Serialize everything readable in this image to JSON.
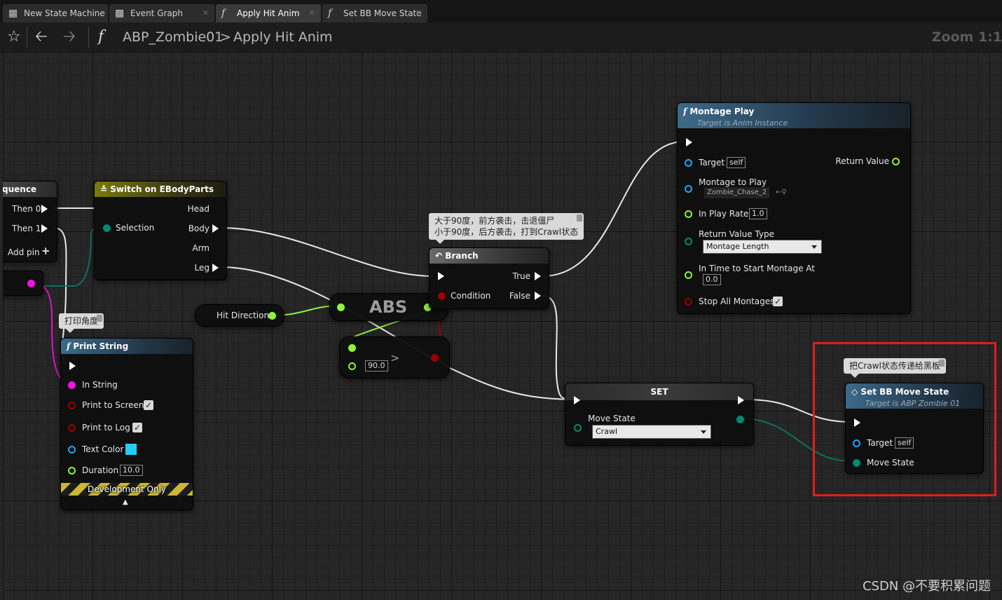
{
  "tabs": [
    {
      "label": "New State Machine",
      "icon": "state-machine-icon",
      "active": false
    },
    {
      "label": "Event Graph",
      "icon": "event-graph-icon",
      "active": false
    },
    {
      "label": "Apply Hit Anim",
      "icon": "function-icon",
      "active": true
    },
    {
      "label": "Set BB Move State",
      "icon": "function-icon",
      "active": false
    }
  ],
  "toolbar": {
    "blueprint": "ABP_Zombie01",
    "separator": ">",
    "function": "Apply Hit Anim",
    "zoom": "Zoom 1:1"
  },
  "nodes": {
    "sequence": {
      "title": "quence",
      "then0": "Then 0",
      "then1": "Then 1",
      "add_pin": "Add pin"
    },
    "switch": {
      "title": "Switch on EBodyParts",
      "selection": "Selection",
      "head": "Head",
      "body": "Body",
      "arm": "Arm",
      "leg": "Leg"
    },
    "print": {
      "title": "Print String",
      "in_string": "In String",
      "print_to_screen": "Print to Screen",
      "print_to_log": "Print to Log",
      "text_color": "Text Color",
      "duration": "Duration",
      "duration_value": "10.0",
      "dev_only": "Development Only"
    },
    "hit_direction": {
      "label": "Hit Direction"
    },
    "abs": {
      "label": "ABS"
    },
    "greater": {
      "value": "90.0",
      "symbol": ">"
    },
    "branch": {
      "title": "Branch",
      "true": "True",
      "condition": "Condition",
      "false": "False"
    },
    "montage": {
      "title": "Montage Play",
      "subtitle": "Target is Anim Instance",
      "target": "Target",
      "self": "self",
      "return_value": "Return Value",
      "montage_to_play": "Montage to Play",
      "montage_asset": "Zombie_Chase_2",
      "play_rate": "In Play Rate",
      "play_rate_value": "1.0",
      "return_value_type": "Return Value Type",
      "return_value_type_value": "Montage Length",
      "time_to_start": "In Time to Start Montage At",
      "time_to_start_value": "0.0",
      "stop_all": "Stop All Montages"
    },
    "set": {
      "title": "SET",
      "move_state": "Move State",
      "move_state_value": "Crawl"
    },
    "set_bb": {
      "title": "Set BB Move State",
      "subtitle": "Target is ABP Zombie 01",
      "target": "Target",
      "self": "self",
      "move_state": "Move State"
    }
  },
  "comments": {
    "print": "打印角度",
    "branch_line1": "大于90度，前方袭击，击退僵尸",
    "branch_line2": "小于90度，后方袭击，打到Crawl状态",
    "set_bb": "把Crawl状态传递给黑板"
  },
  "watermark": "CSDN @不要积累问题",
  "colors": {
    "exec": "#ffffff",
    "object": "#1ea6ff",
    "float": "#8ff23d",
    "bool": "#9b0000",
    "string": "#f413e2",
    "enum": "#008a73",
    "linear_color": "#1ed1f5",
    "highlight": "#e41b1b"
  }
}
